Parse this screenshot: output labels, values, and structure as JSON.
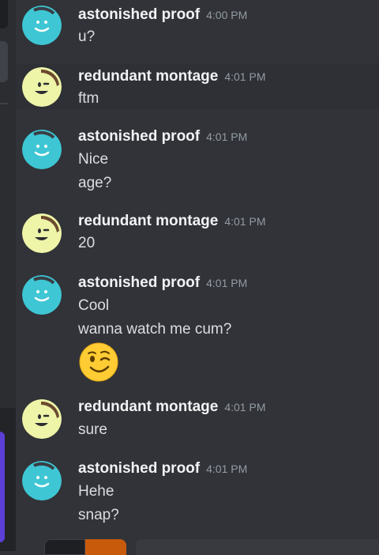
{
  "users": {
    "astonished": {
      "name": "astonished proof",
      "avatar_color": "#3ec6d4"
    },
    "redundant": {
      "name": "redundant montage",
      "avatar_color": "#eef4a8"
    }
  },
  "messages": [
    {
      "user": "astonished proof",
      "time": "4:00 PM",
      "lines": [
        "u?"
      ]
    },
    {
      "user": "redundant montage",
      "time": "4:01 PM",
      "lines": [
        "ftm"
      ],
      "highlighted": true
    },
    {
      "user": "astonished proof",
      "time": "4:01 PM",
      "lines": [
        "Nice",
        "age?"
      ]
    },
    {
      "user": "redundant montage",
      "time": "4:01 PM",
      "lines": [
        "20"
      ]
    },
    {
      "user": "astonished proof",
      "time": "4:01 PM",
      "lines": [
        "Cool",
        "wanna watch me cum?"
      ],
      "emoji": "winking-face-emoji"
    },
    {
      "user": "redundant montage",
      "time": "4:01 PM",
      "lines": [
        "sure"
      ]
    },
    {
      "user": "astonished proof",
      "time": "4:01 PM",
      "lines": [
        "Hehe",
        "snap?"
      ]
    }
  ],
  "colors": {
    "background": "#313338",
    "sidebar": "#2b2d31",
    "accent_purple": "#5b3fd6",
    "accent_orange": "#c85a0c"
  }
}
